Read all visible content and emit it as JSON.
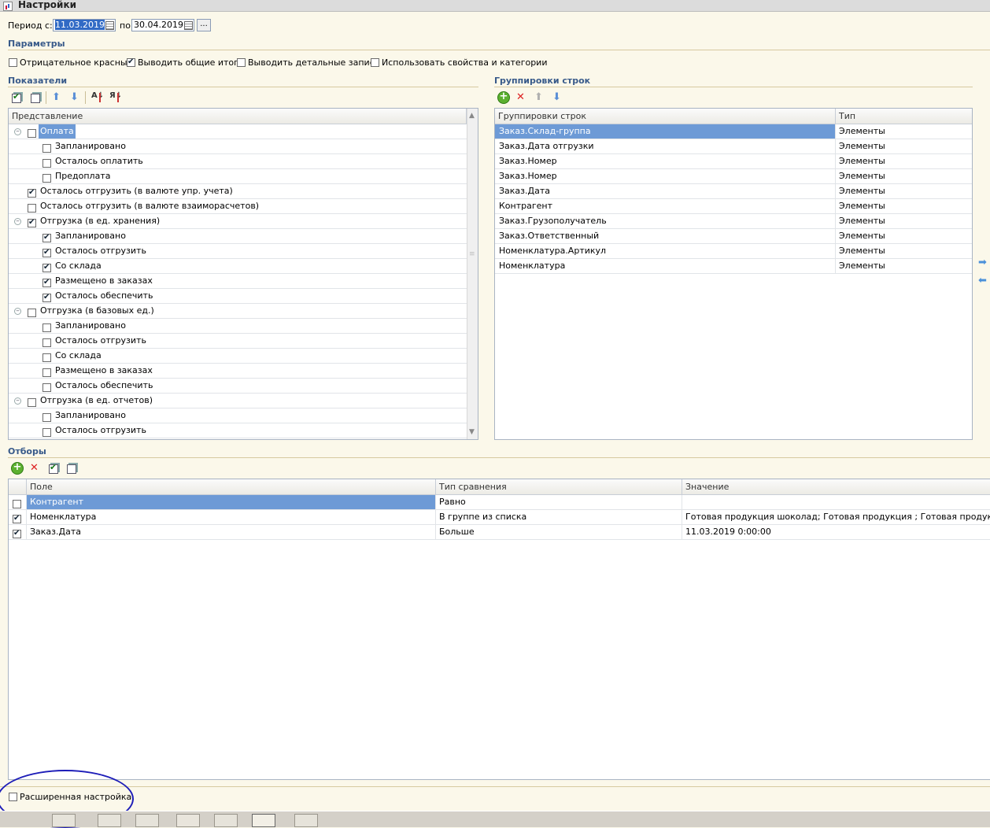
{
  "window": {
    "title": "Настройки"
  },
  "period": {
    "from_label": "Период с:",
    "from_value": "11.03.2019",
    "to_label": "по",
    "to_value": "30.04.2019",
    "more_button": "..."
  },
  "params": {
    "title": "Параметры",
    "options": [
      {
        "label": "Отрицательное красным",
        "checked": false
      },
      {
        "label": "Выводить общие итоги",
        "checked": true
      },
      {
        "label": "Выводить детальные записи",
        "checked": false
      },
      {
        "label": "Использовать свойства и категории",
        "checked": false
      }
    ]
  },
  "indicators": {
    "title": "Показатели",
    "column": "Представление",
    "rows": [
      {
        "label": "Оплата",
        "level": 0,
        "group": true,
        "checked": false,
        "selected": true
      },
      {
        "label": "Запланировано",
        "level": 1,
        "checked": false
      },
      {
        "label": "Осталось оплатить",
        "level": 1,
        "checked": false
      },
      {
        "label": "Предоплата",
        "level": 1,
        "checked": false
      },
      {
        "label": "Осталось отгрузить  (в валюте упр. учета)",
        "level": 0,
        "checked": true
      },
      {
        "label": "Осталось отгрузить  (в валюте взаиморасчетов)",
        "level": 0,
        "checked": false
      },
      {
        "label": "Отгрузка (в ед. хранения)",
        "level": 0,
        "group": true,
        "checked": true
      },
      {
        "label": "Запланировано",
        "level": 1,
        "checked": true
      },
      {
        "label": "Осталось отгрузить",
        "level": 1,
        "checked": true
      },
      {
        "label": "Со склада",
        "level": 1,
        "checked": true
      },
      {
        "label": "Размещено в заказах",
        "level": 1,
        "checked": true
      },
      {
        "label": "Осталось обеспечить",
        "level": 1,
        "checked": true
      },
      {
        "label": "Отгрузка (в базовых ед.)",
        "level": 0,
        "group": true,
        "checked": false
      },
      {
        "label": "Запланировано",
        "level": 1,
        "checked": false
      },
      {
        "label": "Осталось отгрузить",
        "level": 1,
        "checked": false
      },
      {
        "label": "Со склада",
        "level": 1,
        "checked": false
      },
      {
        "label": "Размещено в заказах",
        "level": 1,
        "checked": false
      },
      {
        "label": "Осталось обеспечить",
        "level": 1,
        "checked": false
      },
      {
        "label": "Отгрузка (в ед. отчетов)",
        "level": 0,
        "group": true,
        "checked": false
      },
      {
        "label": "Запланировано",
        "level": 1,
        "checked": false
      },
      {
        "label": "Осталось отгрузить",
        "level": 1,
        "checked": false
      }
    ]
  },
  "groupings": {
    "title": "Группировки строк",
    "columns": [
      "Группировки строк",
      "Тип"
    ],
    "rows": [
      {
        "field": "Заказ.Склад-группа",
        "type": "Элементы",
        "selected": true
      },
      {
        "field": "Заказ.Дата отгрузки",
        "type": "Элементы"
      },
      {
        "field": "Заказ.Номер",
        "type": "Элементы"
      },
      {
        "field": "Заказ.Номер",
        "type": "Элементы"
      },
      {
        "field": "Заказ.Дата",
        "type": "Элементы"
      },
      {
        "field": "Контрагент",
        "type": "Элементы"
      },
      {
        "field": "Заказ.Грузополучатель",
        "type": "Элементы"
      },
      {
        "field": "Заказ.Ответственный",
        "type": "Элементы"
      },
      {
        "field": "Номенклатура.Артикул",
        "type": "Элементы"
      },
      {
        "field": "Номенклатура",
        "type": "Элементы"
      }
    ]
  },
  "filters": {
    "title": "Отборы",
    "columns": [
      "Поле",
      "Тип сравнения",
      "Значение"
    ],
    "rows": [
      {
        "checked": false,
        "field": "Контрагент",
        "comparison": "Равно",
        "value": "",
        "selected": true
      },
      {
        "checked": true,
        "field": "Номенклатура",
        "comparison": "В группе из списка",
        "value": "Готовая продукция шоколад; Готовая продукция ; Готовая продукция экстру"
      },
      {
        "checked": true,
        "field": "Заказ.Дата",
        "comparison": "Больше",
        "value": "11.03.2019 0:00:00"
      }
    ]
  },
  "advanced": {
    "label": "Расширенная настройка",
    "checked": false
  },
  "colors": {
    "accent": "#385a8a",
    "selection": "#6d9ad6",
    "background": "#fbf8ea",
    "annotation": "#1d1db8"
  }
}
